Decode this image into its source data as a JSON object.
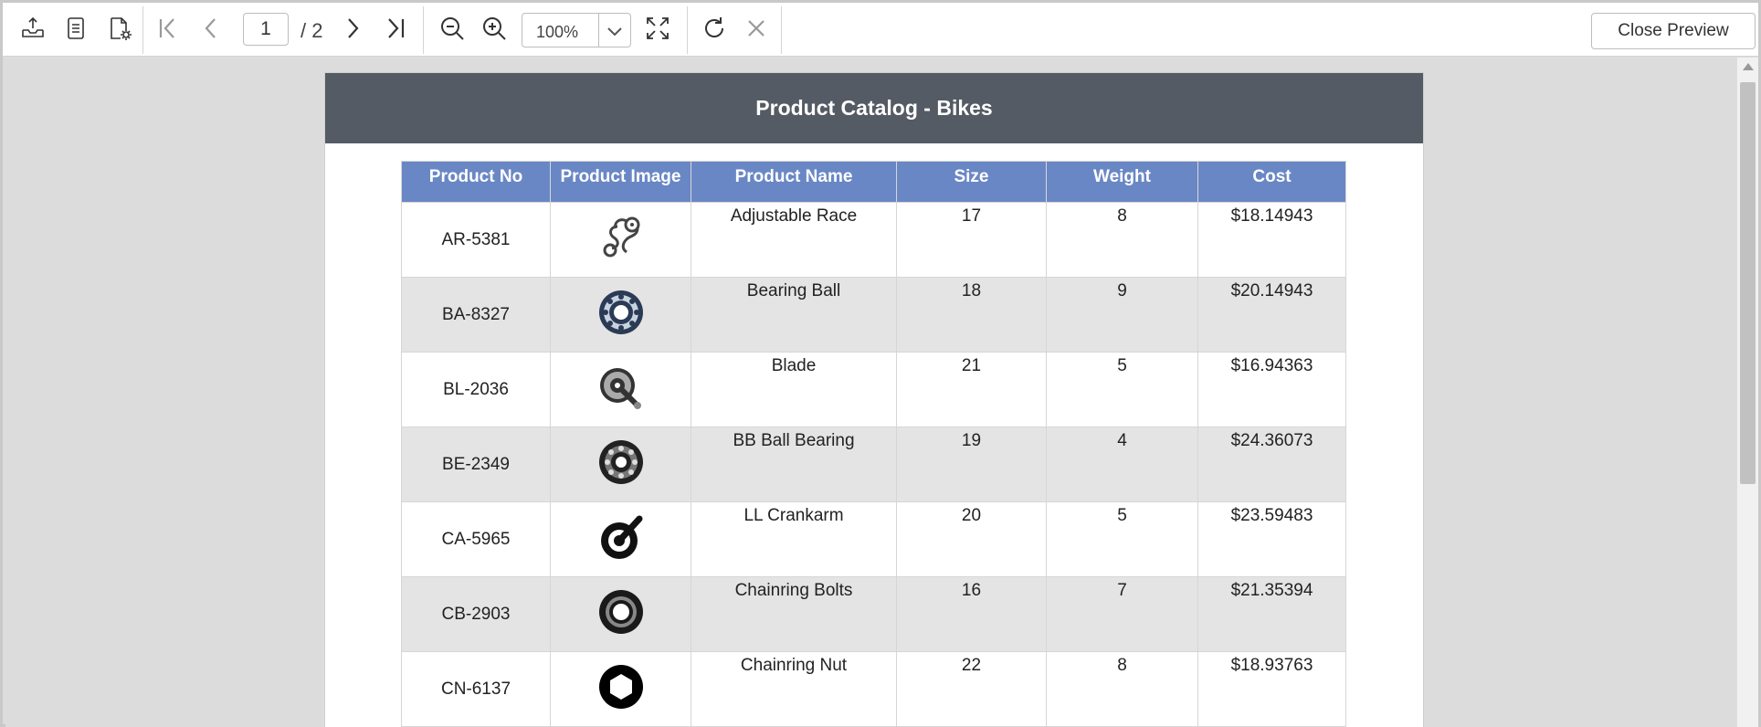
{
  "toolbar": {
    "page_current": "1",
    "page_total": "/ 2",
    "zoom_value": "100%",
    "close_preview_label": "Close Preview"
  },
  "report": {
    "title": "Product Catalog - Bikes",
    "columns": [
      "Product No",
      "Product Image",
      "Product Name",
      "Size",
      "Weight",
      "Cost"
    ],
    "rows": [
      {
        "no": "AR-5381",
        "image": "chain-derailleur-icon",
        "name": "Adjustable Race",
        "size": "17",
        "weight": "8",
        "cost": "$18.14943"
      },
      {
        "no": "BA-8327",
        "image": "bearing-ball-icon",
        "name": "Bearing Ball",
        "size": "18",
        "weight": "9",
        "cost": "$20.14943"
      },
      {
        "no": "BL-2036",
        "image": "crankset-icon",
        "name": "Blade",
        "size": "21",
        "weight": "5",
        "cost": "$16.94363"
      },
      {
        "no": "BE-2349",
        "image": "ball-bearing-icon",
        "name": "BB Ball Bearing",
        "size": "19",
        "weight": "4",
        "cost": "$24.36073"
      },
      {
        "no": "CA-5965",
        "image": "crankarm-icon",
        "name": "LL Crankarm",
        "size": "20",
        "weight": "5",
        "cost": "$23.59483"
      },
      {
        "no": "CB-2903",
        "image": "chainring-icon",
        "name": "Chainring Bolts",
        "size": "16",
        "weight": "7",
        "cost": "$21.35394"
      },
      {
        "no": "CN-6137",
        "image": "hex-nut-icon",
        "name": "Chainring Nut",
        "size": "22",
        "weight": "8",
        "cost": "$18.93763"
      }
    ]
  },
  "colors": {
    "header_band": "#555b64",
    "table_header": "#6a87c5",
    "alt_row": "#e4e4e4"
  }
}
